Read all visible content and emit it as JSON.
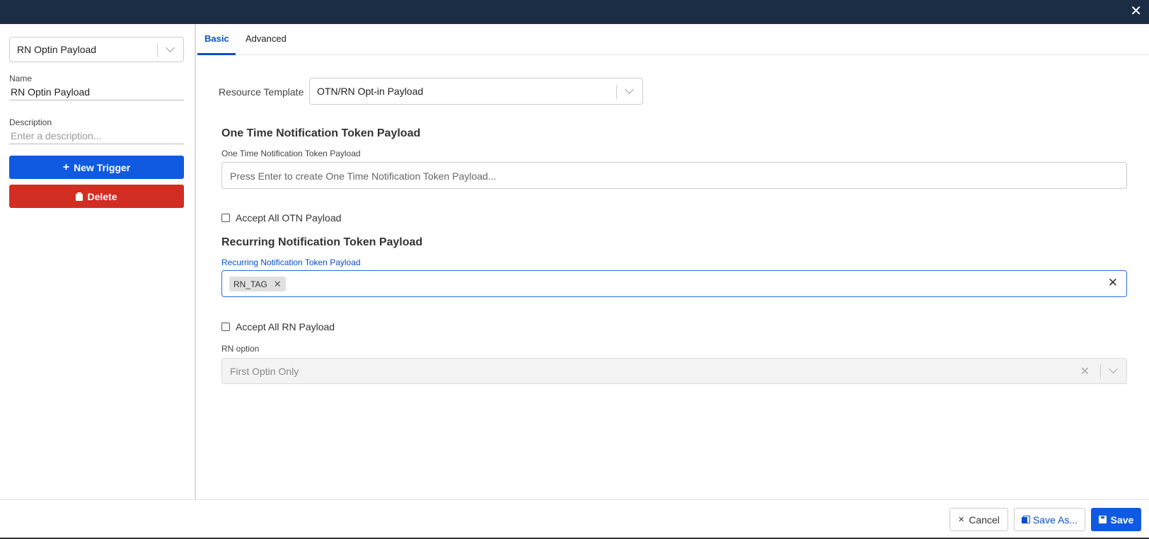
{
  "window": {
    "close_glyph": "✕"
  },
  "sidebar": {
    "selector_value": "RN Optin Payload",
    "name_label": "Name",
    "name_value": "RN Optin Payload",
    "description_label": "Description",
    "description_placeholder": "Enter a description...",
    "new_trigger_label": "New Trigger",
    "delete_label": "Delete"
  },
  "tabs": [
    {
      "label": "Basic",
      "active": true
    },
    {
      "label": "Advanced",
      "active": false
    }
  ],
  "form": {
    "resource_template_label": "Resource Template",
    "resource_template_value": "OTN/RN Opt-in Payload",
    "otn_section_title": "One Time Notification Token Payload",
    "otn_field_label": "One Time Notification Token Payload",
    "otn_field_placeholder": "Press Enter to create One Time Notification Token Payload...",
    "accept_otn_label": "Accept All OTN Payload",
    "rn_section_title": "Recurring Notification Token Payload",
    "rn_field_label": "Recurring Notification Token Payload",
    "rn_tags": [
      "RN_TAG"
    ],
    "accept_rn_label": "Accept All RN Payload",
    "rn_option_label": "RN option",
    "rn_option_value": "First Optin Only"
  },
  "footer": {
    "cancel_label": "Cancel",
    "save_as_label": "Save As...",
    "save_label": "Save"
  },
  "colors": {
    "topbar": "#1b2d45",
    "primary": "#0f5ae0",
    "danger": "#d22d22",
    "active_tab": "#0b4fcb"
  }
}
